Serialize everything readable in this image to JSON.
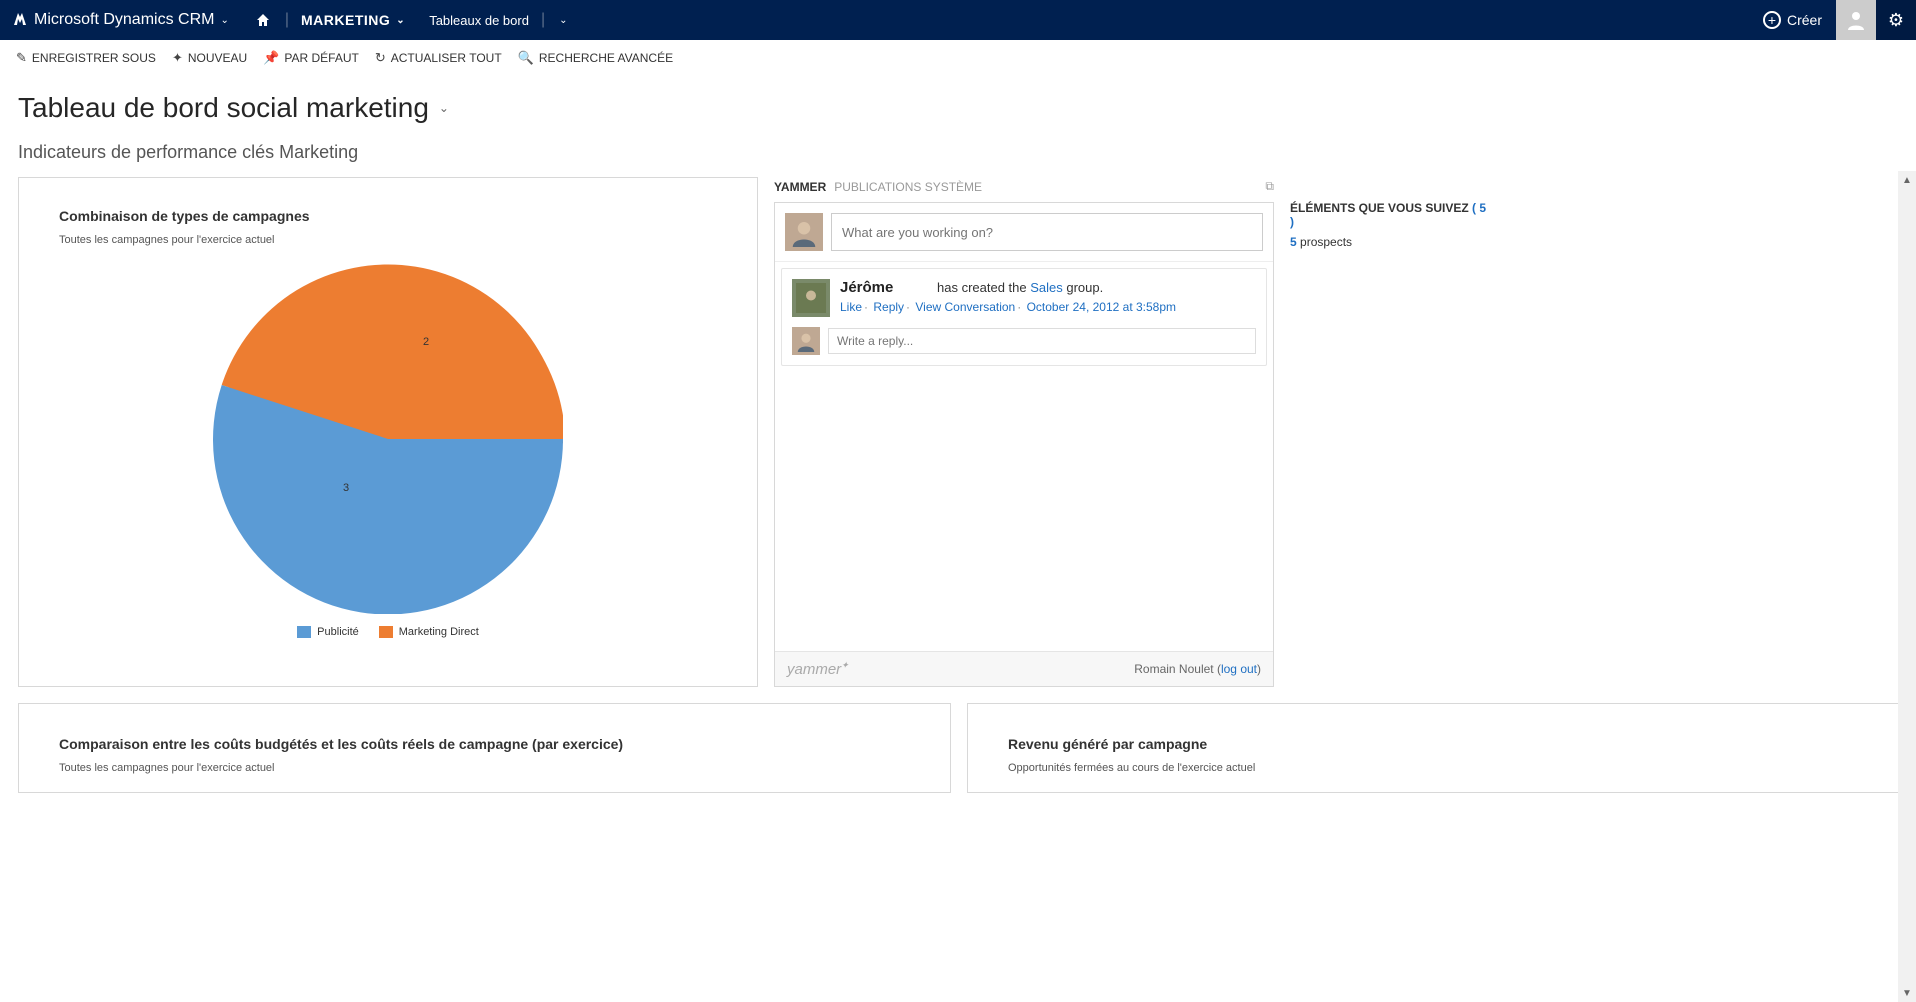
{
  "nav": {
    "brand": "Microsoft Dynamics CRM",
    "area": "MARKETING",
    "subarea": "Tableaux de bord",
    "create": "Créer"
  },
  "commands": {
    "save_as": "ENREGISTRER SOUS",
    "new": "NOUVEAU",
    "default": "PAR DÉFAUT",
    "refresh_all": "ACTUALISER TOUT",
    "adv_find": "RECHERCHE AVANCÉE"
  },
  "page": {
    "title": "Tableau de bord social marketing",
    "section": "Indicateurs de performance clés Marketing"
  },
  "chart_data": {
    "type": "pie",
    "title": "Combinaison de types de campagnes",
    "subtitle": "Toutes les campagnes pour l'exercice actuel",
    "series": [
      {
        "name": "Publicité",
        "value": 3,
        "color": "#5b9bd5"
      },
      {
        "name": "Marketing Direct",
        "value": 2,
        "color": "#ed7d31"
      }
    ]
  },
  "yammer": {
    "tab_active": "YAMMER",
    "tab_inactive": "PUBLICATIONS SYSTÈME",
    "compose_placeholder": "What are you working on?",
    "post": {
      "author": "Jérôme",
      "action_pre": "has created the ",
      "action_link": "Sales",
      "action_post": " group.",
      "like": "Like",
      "reply": "Reply",
      "view": "View Conversation",
      "timestamp": "October 24, 2012 at 3:58pm",
      "reply_placeholder": "Write a reply..."
    },
    "footer_brand": "yammer",
    "footer_user": "Romain Noulet",
    "logout": "log out"
  },
  "follow": {
    "title_pre": "ÉLÉMENTS QUE VOUS SUIVEZ ",
    "title_count": "( 5 )",
    "row_count": "5",
    "row_label": " prospects"
  },
  "bottom_cards": {
    "left_title": "Comparaison entre les coûts budgétés et les coûts réels de campagne (par exercice)",
    "left_sub": "Toutes les campagnes pour l'exercice actuel",
    "right_title": "Revenu généré par campagne",
    "right_sub": "Opportunités fermées au cours de l'exercice actuel"
  }
}
